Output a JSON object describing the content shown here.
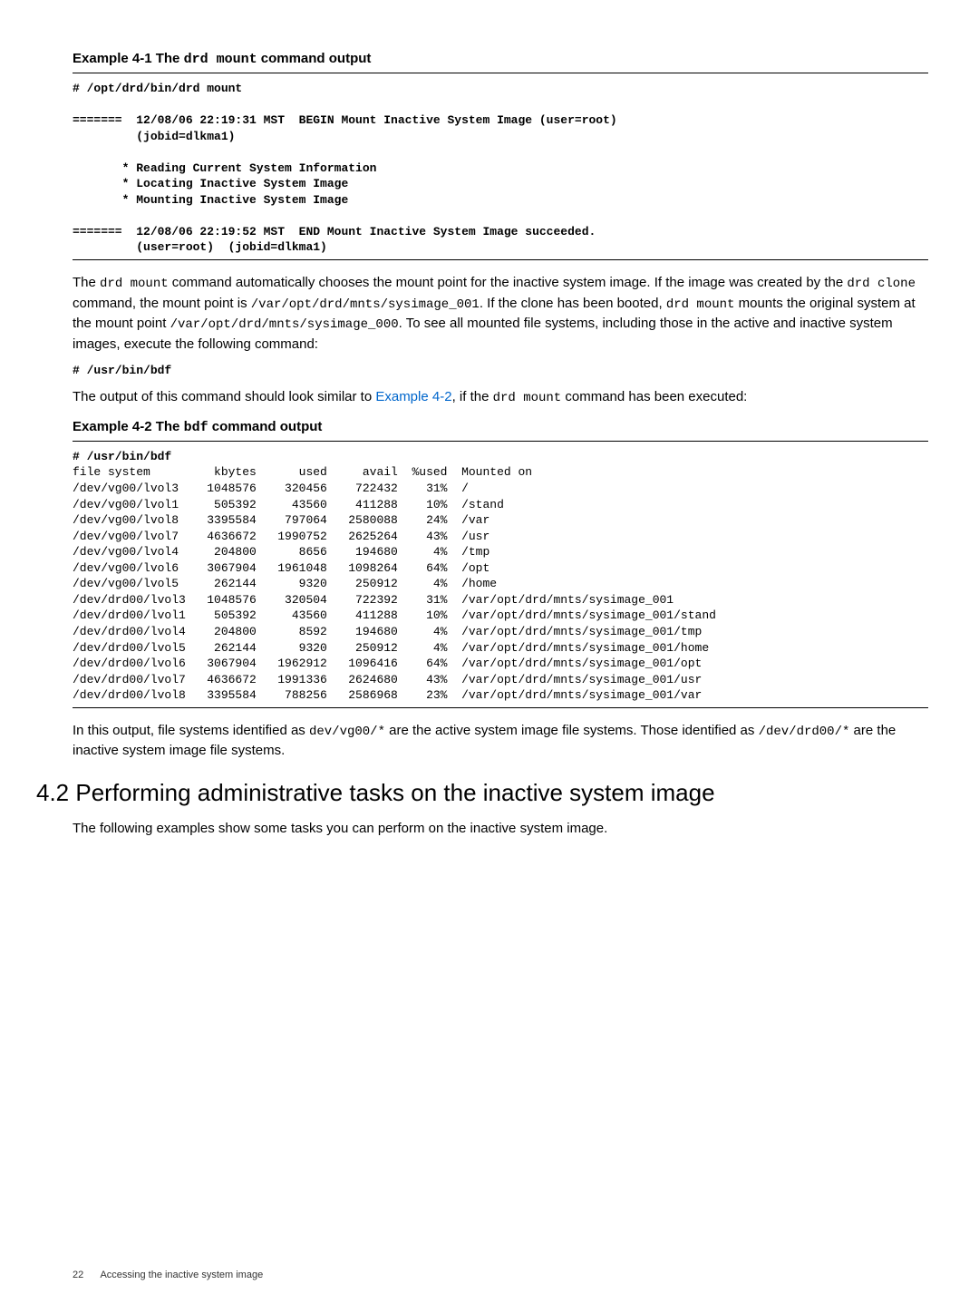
{
  "ex41": {
    "heading_prefix": "Example 4-1 The ",
    "heading_code": "drd mount",
    "heading_suffix": " command output",
    "code": "# /opt/drd/bin/drd mount\n\n=======  12/08/06 22:19:31 MST  BEGIN Mount Inactive System Image (user=root)\n         (jobid=dlkma1)\n\n       * Reading Current System Information\n       * Locating Inactive System Image\n       * Mounting Inactive System Image\n\n=======  12/08/06 22:19:52 MST  END Mount Inactive System Image succeeded.\n         (user=root)  (jobid=dlkma1)"
  },
  "para1": {
    "t1": "The ",
    "c1": "drd mount",
    "t2": " command automatically chooses the mount point for the inactive system image. If the image was created by the ",
    "c2": "drd clone",
    "t3": " command, the mount point is ",
    "c3": "/var/opt/drd/mnts/sysimage_001",
    "t4": ". If the clone has been booted, ",
    "c4": "drd mount",
    "t5": " mounts the original system at the mount point ",
    "c5": "/var/opt/drd/mnts/sysimage_000",
    "t6": ". To see all mounted file systems, including those in the active and inactive system images, execute the following command:"
  },
  "cmd1": "# /usr/bin/bdf",
  "para2": {
    "t1": "The output of this command should look similar to ",
    "link": "Example 4-2",
    "t2": ", if the ",
    "c1": "drd mount",
    "t3": " command has been executed:"
  },
  "ex42": {
    "heading_prefix": "Example 4-2  The ",
    "heading_code": "bdf",
    "heading_suffix": " command output",
    "code": "# /usr/bin/bdf\nfile system         kbytes      used     avail  %used  Mounted on\n/dev/vg00/lvol3    1048576    320456    722432    31%  /\n/dev/vg00/lvol1     505392     43560    411288    10%  /stand\n/dev/vg00/lvol8    3395584    797064   2580088    24%  /var\n/dev/vg00/lvol7    4636672   1990752   2625264    43%  /usr\n/dev/vg00/lvol4     204800      8656    194680     4%  /tmp\n/dev/vg00/lvol6    3067904   1961048   1098264    64%  /opt\n/dev/vg00/lvol5     262144      9320    250912     4%  /home\n/dev/drd00/lvol3   1048576    320504    722392    31%  /var/opt/drd/mnts/sysimage_001\n/dev/drd00/lvol1    505392     43560    411288    10%  /var/opt/drd/mnts/sysimage_001/stand\n/dev/drd00/lvol4    204800      8592    194680     4%  /var/opt/drd/mnts/sysimage_001/tmp\n/dev/drd00/lvol5    262144      9320    250912     4%  /var/opt/drd/mnts/sysimage_001/home\n/dev/drd00/lvol6   3067904   1962912   1096416    64%  /var/opt/drd/mnts/sysimage_001/opt\n/dev/drd00/lvol7   4636672   1991336   2624680    43%  /var/opt/drd/mnts/sysimage_001/usr\n/dev/drd00/lvol8   3395584    788256   2586968    23%  /var/opt/drd/mnts/sysimage_001/var"
  },
  "para3": {
    "t1": "In this output, file systems identified as ",
    "c1": "dev/vg00/*",
    "t2": " are the active system image file systems. Those identified as ",
    "c2": "/dev/drd00/*",
    "t3": " are the inactive system image file systems."
  },
  "section": "4.2 Performing administrative tasks on the inactive system image",
  "para4": "The following examples show some tasks you can perform on the inactive system image.",
  "footer": {
    "page": "22",
    "title": "Accessing the inactive system image"
  }
}
